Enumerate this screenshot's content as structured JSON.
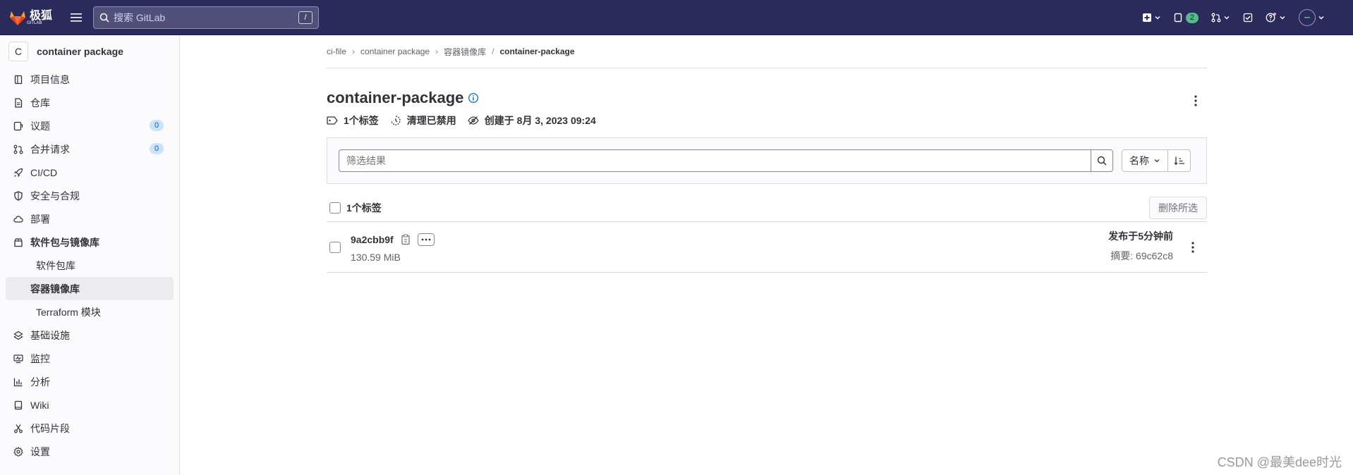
{
  "brand": {
    "logo_text": "极狐",
    "logo_sub": "GITLAB"
  },
  "search": {
    "placeholder": "搜索 GitLab",
    "shortcut": "/"
  },
  "topbar": {
    "issues_count": "2"
  },
  "sidebar": {
    "project_initial": "C",
    "project_name": "container package",
    "items": [
      {
        "label": "项目信息",
        "icon": "info-book-icon"
      },
      {
        "label": "仓库",
        "icon": "doc-icon"
      },
      {
        "label": "议题",
        "icon": "issues-icon",
        "count": "0"
      },
      {
        "label": "合并请求",
        "icon": "merge-request-icon",
        "count": "0"
      },
      {
        "label": "CI/CD",
        "icon": "rocket-icon"
      },
      {
        "label": "安全与合规",
        "icon": "shield-icon"
      },
      {
        "label": "部署",
        "icon": "cloud-icon"
      },
      {
        "label": "软件包与镜像库",
        "icon": "package-icon"
      },
      {
        "label": "基础设施",
        "icon": "infra-icon"
      },
      {
        "label": "监控",
        "icon": "monitor-icon"
      },
      {
        "label": "分析",
        "icon": "chart-icon"
      },
      {
        "label": "Wiki",
        "icon": "book-icon"
      },
      {
        "label": "代码片段",
        "icon": "snippet-icon"
      },
      {
        "label": "设置",
        "icon": "gear-icon"
      }
    ],
    "subitems": [
      {
        "label": "软件包库"
      },
      {
        "label": "容器镜像库"
      },
      {
        "label": "Terraform 模块"
      }
    ]
  },
  "breadcrumbs": {
    "items": [
      "ci-file",
      "container package",
      "容器镜像库"
    ],
    "current": "container-package"
  },
  "page": {
    "title": "container-package",
    "meta": {
      "tags": "1个标签",
      "cleanup": "清理已禁用",
      "created": "创建于 8月 3, 2023 09:24"
    }
  },
  "filter": {
    "placeholder": "筛选结果",
    "sort_label": "名称"
  },
  "list": {
    "header_label": "1个标签",
    "delete_label": "删除所选",
    "rows": [
      {
        "tag": "9a2cbb9f",
        "size": "130.59 MiB",
        "published": "发布于5分钟前",
        "digest": "摘要: 69c62c8"
      }
    ]
  },
  "watermark": "CSDN @最美dee时光"
}
